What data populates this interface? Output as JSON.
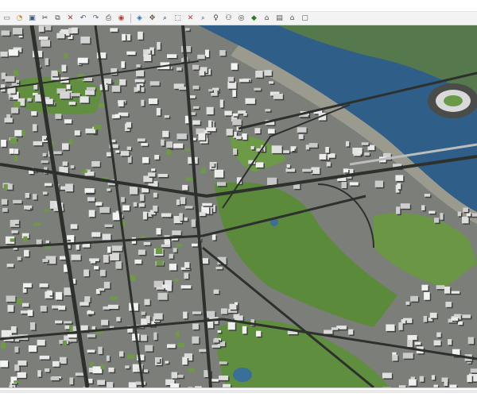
{
  "toolbar": {
    "tools": [
      {
        "name": "new-icon",
        "glyph": "▭",
        "color": "#5a6f86"
      },
      {
        "name": "open-icon",
        "glyph": "◔",
        "color": "#c58b2b"
      },
      {
        "name": "save-icon",
        "glyph": "▣",
        "color": "#3c5a8a"
      },
      {
        "name": "cut-icon",
        "glyph": "✂",
        "color": "#333333"
      },
      {
        "name": "copy-icon",
        "glyph": "⧉",
        "color": "#4b4b4b"
      },
      {
        "name": "delete-icon",
        "glyph": "✕",
        "color": "#b22222"
      },
      {
        "name": "undo-icon",
        "glyph": "↶",
        "color": "#355d9a"
      },
      {
        "name": "redo-icon",
        "glyph": "↷",
        "color": "#355d9a"
      },
      {
        "name": "print-icon",
        "glyph": "⎙",
        "color": "#444444"
      },
      {
        "name": "model-info-icon",
        "glyph": "◉",
        "color": "#c0392b"
      },
      {
        "name": "separator",
        "glyph": "",
        "color": ""
      },
      {
        "name": "orbit-icon",
        "glyph": "◈",
        "color": "#2d6db3"
      },
      {
        "name": "pan-icon",
        "glyph": "✥",
        "color": "#7a4b1e"
      },
      {
        "name": "zoom-icon",
        "glyph": "⌕",
        "color": "#333333"
      },
      {
        "name": "zoom-window-icon",
        "glyph": "⬚",
        "color": "#335577"
      },
      {
        "name": "zoom-extents-icon",
        "glyph": "✕",
        "color": "#b33a3a"
      },
      {
        "name": "previous-view-icon",
        "glyph": "⌕",
        "color": "#2a5e9e"
      },
      {
        "name": "position-camera-icon",
        "glyph": "♀",
        "color": "#444444"
      },
      {
        "name": "walk-icon",
        "glyph": "⚇",
        "color": "#444444"
      },
      {
        "name": "look-around-icon",
        "glyph": "◎",
        "color": "#444444"
      },
      {
        "name": "section-plane-icon",
        "glyph": "◆",
        "color": "#2a7a2a"
      },
      {
        "name": "iso-view-icon",
        "glyph": "⌂",
        "color": "#555555"
      },
      {
        "name": "top-view-icon",
        "glyph": "▤",
        "color": "#555555"
      },
      {
        "name": "front-view-icon",
        "glyph": "⌂",
        "color": "#555555"
      },
      {
        "name": "left-view-icon",
        "glyph": "▢",
        "color": "#555555"
      }
    ]
  },
  "viewport": {
    "content": "3D city model aerial view",
    "colors": {
      "ground": "#7c7e79",
      "river": "#2f5f88",
      "park": "#5b8a3a",
      "park_light": "#7aa34e",
      "building": "#dcdcdc",
      "shadow": "#555854",
      "road": "#2e302e"
    }
  }
}
